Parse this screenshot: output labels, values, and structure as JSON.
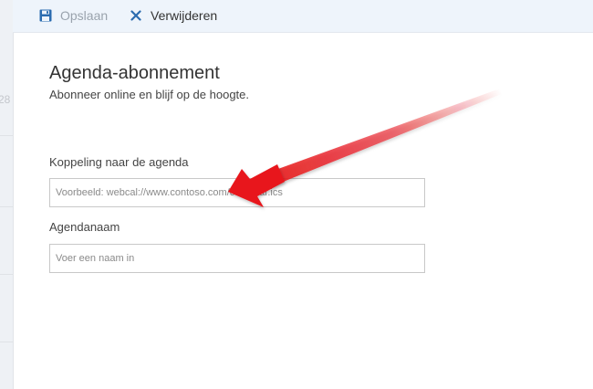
{
  "toolbar": {
    "save_label": "Opslaan",
    "delete_label": "Verwijderen",
    "save_icon": "save-icon",
    "delete_icon": "close-icon"
  },
  "background": {
    "partial_number": "28"
  },
  "panel": {
    "title": "Agenda-abonnement",
    "subtitle": "Abonneer online en blijf op de hoogte."
  },
  "form": {
    "calendar_link": {
      "label": "Koppeling naar de agenda",
      "placeholder": "Voorbeeld: webcal://www.contoso.com/calendar.ics",
      "value": ""
    },
    "calendar_name": {
      "label": "Agendanaam",
      "placeholder": "Voer een naam in",
      "value": ""
    }
  },
  "colors": {
    "toolbar_bg": "#eef4fb",
    "accent": "#2b6cb0",
    "annotation_arrow": "#e8151b"
  }
}
